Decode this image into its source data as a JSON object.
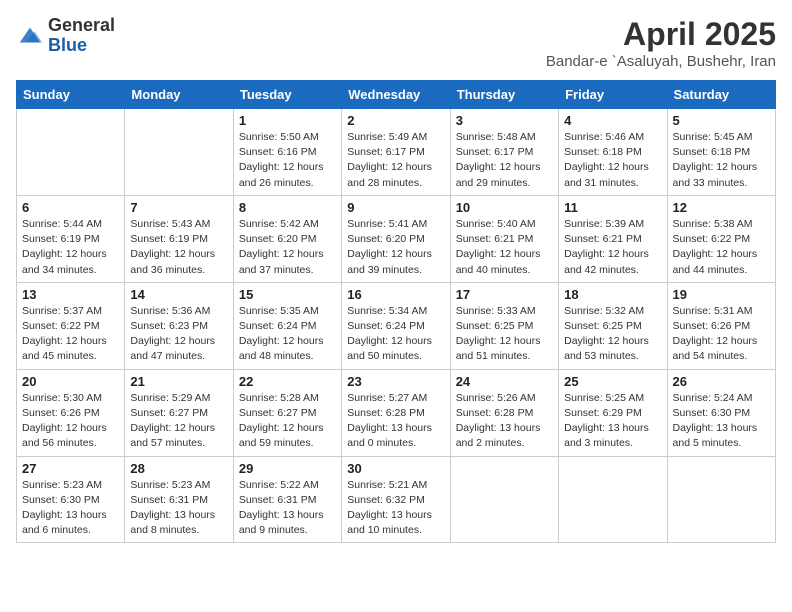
{
  "logo": {
    "line1": "General",
    "line2": "Blue"
  },
  "title": "April 2025",
  "subtitle": "Bandar-e `Asaluyah, Bushehr, Iran",
  "days_of_week": [
    "Sunday",
    "Monday",
    "Tuesday",
    "Wednesday",
    "Thursday",
    "Friday",
    "Saturday"
  ],
  "weeks": [
    [
      {
        "day": "",
        "info": ""
      },
      {
        "day": "",
        "info": ""
      },
      {
        "day": "1",
        "info": "Sunrise: 5:50 AM\nSunset: 6:16 PM\nDaylight: 12 hours and 26 minutes."
      },
      {
        "day": "2",
        "info": "Sunrise: 5:49 AM\nSunset: 6:17 PM\nDaylight: 12 hours and 28 minutes."
      },
      {
        "day": "3",
        "info": "Sunrise: 5:48 AM\nSunset: 6:17 PM\nDaylight: 12 hours and 29 minutes."
      },
      {
        "day": "4",
        "info": "Sunrise: 5:46 AM\nSunset: 6:18 PM\nDaylight: 12 hours and 31 minutes."
      },
      {
        "day": "5",
        "info": "Sunrise: 5:45 AM\nSunset: 6:18 PM\nDaylight: 12 hours and 33 minutes."
      }
    ],
    [
      {
        "day": "6",
        "info": "Sunrise: 5:44 AM\nSunset: 6:19 PM\nDaylight: 12 hours and 34 minutes."
      },
      {
        "day": "7",
        "info": "Sunrise: 5:43 AM\nSunset: 6:19 PM\nDaylight: 12 hours and 36 minutes."
      },
      {
        "day": "8",
        "info": "Sunrise: 5:42 AM\nSunset: 6:20 PM\nDaylight: 12 hours and 37 minutes."
      },
      {
        "day": "9",
        "info": "Sunrise: 5:41 AM\nSunset: 6:20 PM\nDaylight: 12 hours and 39 minutes."
      },
      {
        "day": "10",
        "info": "Sunrise: 5:40 AM\nSunset: 6:21 PM\nDaylight: 12 hours and 40 minutes."
      },
      {
        "day": "11",
        "info": "Sunrise: 5:39 AM\nSunset: 6:21 PM\nDaylight: 12 hours and 42 minutes."
      },
      {
        "day": "12",
        "info": "Sunrise: 5:38 AM\nSunset: 6:22 PM\nDaylight: 12 hours and 44 minutes."
      }
    ],
    [
      {
        "day": "13",
        "info": "Sunrise: 5:37 AM\nSunset: 6:22 PM\nDaylight: 12 hours and 45 minutes."
      },
      {
        "day": "14",
        "info": "Sunrise: 5:36 AM\nSunset: 6:23 PM\nDaylight: 12 hours and 47 minutes."
      },
      {
        "day": "15",
        "info": "Sunrise: 5:35 AM\nSunset: 6:24 PM\nDaylight: 12 hours and 48 minutes."
      },
      {
        "day": "16",
        "info": "Sunrise: 5:34 AM\nSunset: 6:24 PM\nDaylight: 12 hours and 50 minutes."
      },
      {
        "day": "17",
        "info": "Sunrise: 5:33 AM\nSunset: 6:25 PM\nDaylight: 12 hours and 51 minutes."
      },
      {
        "day": "18",
        "info": "Sunrise: 5:32 AM\nSunset: 6:25 PM\nDaylight: 12 hours and 53 minutes."
      },
      {
        "day": "19",
        "info": "Sunrise: 5:31 AM\nSunset: 6:26 PM\nDaylight: 12 hours and 54 minutes."
      }
    ],
    [
      {
        "day": "20",
        "info": "Sunrise: 5:30 AM\nSunset: 6:26 PM\nDaylight: 12 hours and 56 minutes."
      },
      {
        "day": "21",
        "info": "Sunrise: 5:29 AM\nSunset: 6:27 PM\nDaylight: 12 hours and 57 minutes."
      },
      {
        "day": "22",
        "info": "Sunrise: 5:28 AM\nSunset: 6:27 PM\nDaylight: 12 hours and 59 minutes."
      },
      {
        "day": "23",
        "info": "Sunrise: 5:27 AM\nSunset: 6:28 PM\nDaylight: 13 hours and 0 minutes."
      },
      {
        "day": "24",
        "info": "Sunrise: 5:26 AM\nSunset: 6:28 PM\nDaylight: 13 hours and 2 minutes."
      },
      {
        "day": "25",
        "info": "Sunrise: 5:25 AM\nSunset: 6:29 PM\nDaylight: 13 hours and 3 minutes."
      },
      {
        "day": "26",
        "info": "Sunrise: 5:24 AM\nSunset: 6:30 PM\nDaylight: 13 hours and 5 minutes."
      }
    ],
    [
      {
        "day": "27",
        "info": "Sunrise: 5:23 AM\nSunset: 6:30 PM\nDaylight: 13 hours and 6 minutes."
      },
      {
        "day": "28",
        "info": "Sunrise: 5:23 AM\nSunset: 6:31 PM\nDaylight: 13 hours and 8 minutes."
      },
      {
        "day": "29",
        "info": "Sunrise: 5:22 AM\nSunset: 6:31 PM\nDaylight: 13 hours and 9 minutes."
      },
      {
        "day": "30",
        "info": "Sunrise: 5:21 AM\nSunset: 6:32 PM\nDaylight: 13 hours and 10 minutes."
      },
      {
        "day": "",
        "info": ""
      },
      {
        "day": "",
        "info": ""
      },
      {
        "day": "",
        "info": ""
      }
    ]
  ]
}
